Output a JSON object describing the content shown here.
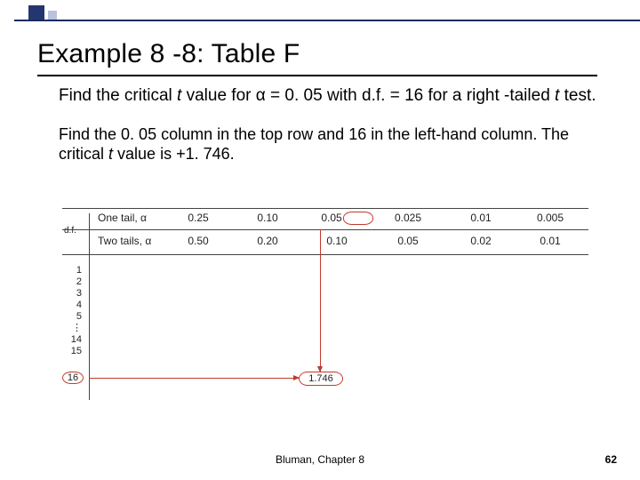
{
  "title": "Example 8 -8: Table F",
  "body": {
    "p1_a": "Find the critical ",
    "p1_b": " value for ",
    "p1_alpha": "α",
    "p1_c": " = 0. 05 with d.f. = 16 for a right -tailed ",
    "p1_d": " test.",
    "p2_a": "Find the 0. 05 column in the top row and 16 in the left-hand column. The critical ",
    "p2_b": " value  is +1. 746.",
    "t": "t"
  },
  "figure": {
    "df_label": "d.f.",
    "one_tail_label": "One tail, α",
    "two_tail_label": "Two tails, α",
    "one_tail": [
      "0.25",
      "0.10",
      "0.05",
      "0.025",
      "0.01",
      "0.005"
    ],
    "two_tail": [
      "0.50",
      "0.20",
      "0.10",
      "0.05",
      "0.02",
      "0.01"
    ],
    "df_rows": [
      "1",
      "2",
      "3",
      "4",
      "5",
      "⋮",
      "14",
      "15"
    ],
    "df_highlight": "16",
    "t_value": "1.746"
  },
  "footer": {
    "center": "Bluman, Chapter 8",
    "page": "62"
  },
  "chart_data": {
    "type": "table",
    "title": "Table F excerpt — critical t values",
    "columns_one_tail_alpha": [
      0.25,
      0.1,
      0.05,
      0.025,
      0.01,
      0.005
    ],
    "columns_two_tail_alpha": [
      0.5,
      0.2,
      0.1,
      0.05,
      0.02,
      0.01
    ],
    "highlighted_cell": {
      "df": 16,
      "one_tail_alpha": 0.05,
      "t": 1.746
    }
  }
}
